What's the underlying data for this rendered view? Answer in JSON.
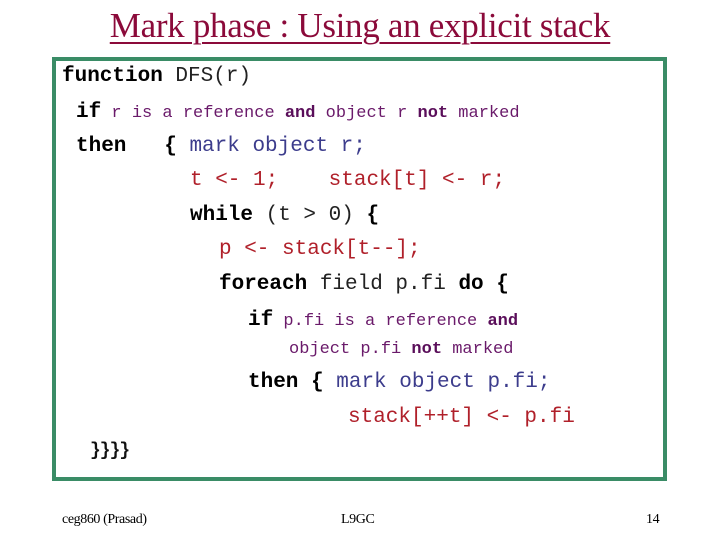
{
  "slide": {
    "title": "Mark phase : Using an explicit stack",
    "code": {
      "l1": {
        "kw": "function",
        "rest": " DFS(r)"
      },
      "l2": {
        "kw": "if",
        "a": " r is a reference ",
        "and": "and",
        "b": " object r ",
        "not": "not",
        "c": " marked"
      },
      "l3": {
        "kw": "then",
        "brace": "{",
        "rest": " mark object r;"
      },
      "l4": {
        "a": "t <- 1;",
        "b": "stack[t] <- r;"
      },
      "l5": {
        "kw": "while",
        "rest": " (t > 0) ",
        "brace": "{"
      },
      "l6": {
        "text": "p <- stack[t--];"
      },
      "l7": {
        "kw": "foreach",
        "rest": " field p.fi ",
        "kw2": "do",
        "brace": " {"
      },
      "l8": {
        "kw": "if",
        "a": " p.fi is a reference ",
        "and": "and"
      },
      "l9": {
        "a": "object p.fi ",
        "not": "not",
        "b": " marked"
      },
      "l10": {
        "kw": "then",
        "brace": " {",
        "rest": " mark object p.fi;"
      },
      "l11": {
        "text": "stack[++t] <- p.fi"
      },
      "l12": {
        "text": "}}}}"
      }
    },
    "colors": {
      "title": "#8b0a3a",
      "border": "#3a8c66",
      "condition": "#6a1a6a",
      "mark": "#3c3c8c",
      "stack_ops": "#b0202a"
    }
  },
  "footer": {
    "left": "ceg860 (Prasad)",
    "center": "L9GC",
    "page": "14"
  }
}
